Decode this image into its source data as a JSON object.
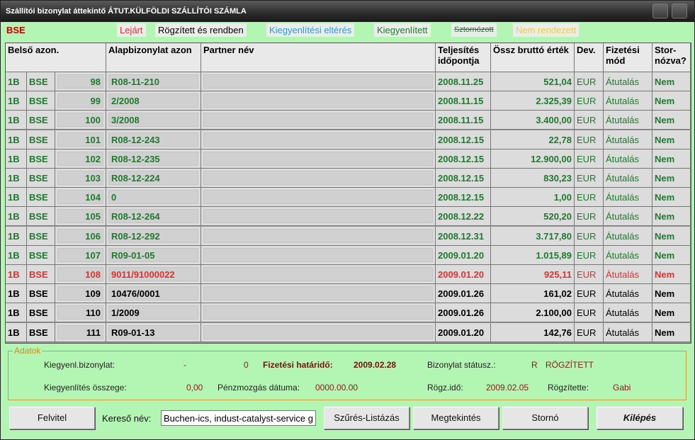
{
  "window": {
    "title": "Szállítói bizonylat áttekintő ÁTUT.KÜLFÖLDI SZÁLLÍTÓI SZÁMLA"
  },
  "legend": {
    "bse": "BSE",
    "items": [
      {
        "label": "Lejárt",
        "color": "#e03030"
      },
      {
        "label": "Rögzített és rendben",
        "color": "#000000"
      },
      {
        "label": "Kiegyenlítési eltérés",
        "color": "#2a9bd0"
      },
      {
        "label": "Kiegyenlített",
        "color": "#1f7a2e"
      },
      {
        "label": "Sztornózott",
        "color": "#1f7a2e"
      },
      {
        "label": "Nem rendezett",
        "color": "#e8d040"
      }
    ]
  },
  "table": {
    "headers": {
      "belso": "Belső azon.",
      "alap": "Alapbizonylat azon",
      "partner": "Partner név",
      "telj": "Teljesítés időpontja",
      "brutto": "Össz bruttó érték",
      "dev": "Dev.",
      "fiz": "Fizetési mód",
      "storno": "Stor- nózva?"
    },
    "rows": [
      {
        "c1": "1B",
        "c2": "BSE",
        "c3": "98",
        "c4": "R08-11-210",
        "c5": "",
        "c6": "2008.11.25",
        "c7": "521,04",
        "c8": "EUR",
        "c9": "Átutalás",
        "c10": "Nem",
        "status": "green"
      },
      {
        "c1": "1B",
        "c2": "BSE",
        "c3": "99",
        "c4": "2/2008",
        "c5": "",
        "c6": "2008.11.15",
        "c7": "2.325,39",
        "c8": "EUR",
        "c9": "Átutalás",
        "c10": "Nem",
        "status": "green"
      },
      {
        "c1": "1B",
        "c2": "BSE",
        "c3": "100",
        "c4": "3/2008",
        "c5": "",
        "c6": "2008.11.15",
        "c7": "3.400,00",
        "c8": "EUR",
        "c9": "Átutalás",
        "c10": "Nem",
        "status": "green"
      },
      {
        "c1": "1B",
        "c2": "BSE",
        "c3": "101",
        "c4": "R08-12-243",
        "c5": "",
        "c6": "2008.12.15",
        "c7": "22,78",
        "c8": "EUR",
        "c9": "Átutalás",
        "c10": "Nem",
        "status": "green"
      },
      {
        "c1": "1B",
        "c2": "BSE",
        "c3": "102",
        "c4": "R08-12-235",
        "c5": "",
        "c6": "2008.12.15",
        "c7": "12.900,00",
        "c8": "EUR",
        "c9": "Átutalás",
        "c10": "Nem",
        "status": "green"
      },
      {
        "c1": "1B",
        "c2": "BSE",
        "c3": "103",
        "c4": "R08-12-224",
        "c5": "",
        "c6": "2008.12.15",
        "c7": "830,23",
        "c8": "EUR",
        "c9": "Átutalás",
        "c10": "Nem",
        "status": "green"
      },
      {
        "c1": "1B",
        "c2": "BSE",
        "c3": "104",
        "c4": "0",
        "c5": "",
        "c6": "2008.12.15",
        "c7": "1,00",
        "c8": "EUR",
        "c9": "Átutalás",
        "c10": "Nem",
        "status": "green"
      },
      {
        "c1": "1B",
        "c2": "BSE",
        "c3": "105",
        "c4": "R08-12-264",
        "c5": "",
        "c6": "2008.12.22",
        "c7": "520,20",
        "c8": "EUR",
        "c9": "Átutalás",
        "c10": "Nem",
        "status": "green"
      },
      {
        "c1": "1B",
        "c2": "BSE",
        "c3": "106",
        "c4": "R08-12-292",
        "c5": "",
        "c6": "2008.12.31",
        "c7": "3.717,80",
        "c8": "EUR",
        "c9": "Átutalás",
        "c10": "Nem",
        "status": "green"
      },
      {
        "c1": "1B",
        "c2": "BSE",
        "c3": "107",
        "c4": "R09-01-05",
        "c5": "",
        "c6": "2009.01.20",
        "c7": "1.015,89",
        "c8": "EUR",
        "c9": "Átutalás",
        "c10": "Nem",
        "status": "green"
      },
      {
        "c1": "1B",
        "c2": "BSE",
        "c3": "108",
        "c4": "9011/91000022",
        "c5": "",
        "c6": "2009.01.20",
        "c7": "925,11",
        "c8": "EUR",
        "c9": "Átutalás",
        "c10": "Nem",
        "status": "red"
      },
      {
        "c1": "1B",
        "c2": "BSE",
        "c3": "109",
        "c4": "10476/0001",
        "c5": "",
        "c6": "2009.01.26",
        "c7": "161,02",
        "c8": "EUR",
        "c9": "Átutalás",
        "c10": "Nem",
        "status": "black"
      },
      {
        "c1": "1B",
        "c2": "BSE",
        "c3": "110",
        "c4": "1/2009",
        "c5": "",
        "c6": "2009.01.26",
        "c7": "2.100,00",
        "c8": "EUR",
        "c9": "Átutalás",
        "c10": "Nem",
        "status": "black"
      },
      {
        "c1": "1B",
        "c2": "BSE",
        "c3": "111",
        "c4": "R09-01-13",
        "c5": "",
        "c6": "2009.01.20",
        "c7": "142,76",
        "c8": "EUR",
        "c9": "Átutalás",
        "c10": "Nem",
        "status": "black",
        "selected": true
      }
    ]
  },
  "details": {
    "legend": "Adatok",
    "kiegyenl_label": "Kiegyenl.bizonylat:",
    "kiegyenl_dash": "-",
    "kiegyenl_num": "0",
    "hatarido_label": "Fizetési határidő:",
    "hatarido_value": "2009.02.28",
    "statusz_label": "Bizonylat státusz.:",
    "statusz_code": "R",
    "statusz_text": "RÖGZÍTETT",
    "osszeg_label": "Kiegyenlítés összege:",
    "osszeg_value": "0,00",
    "penzmozgas_label": "Pénzmozgás dátuma:",
    "penzmozgas_value": "0000.00.00",
    "rogzido_label": "Rögz.idő:",
    "rogzido_value": "2009.02.05",
    "rogzitette_label": "Rögzítette:",
    "rogzitette_value": "Gabi"
  },
  "toolbar": {
    "felvitel": "Felvitel",
    "search_label": "Kereső név:",
    "search_value": "Buchen-ics, indust-catalyst-service g",
    "szures": "Szűrés-Listázás",
    "megtekintes": "Megtekintés",
    "storno": "Stornó",
    "kilepes": "Kilépés"
  }
}
